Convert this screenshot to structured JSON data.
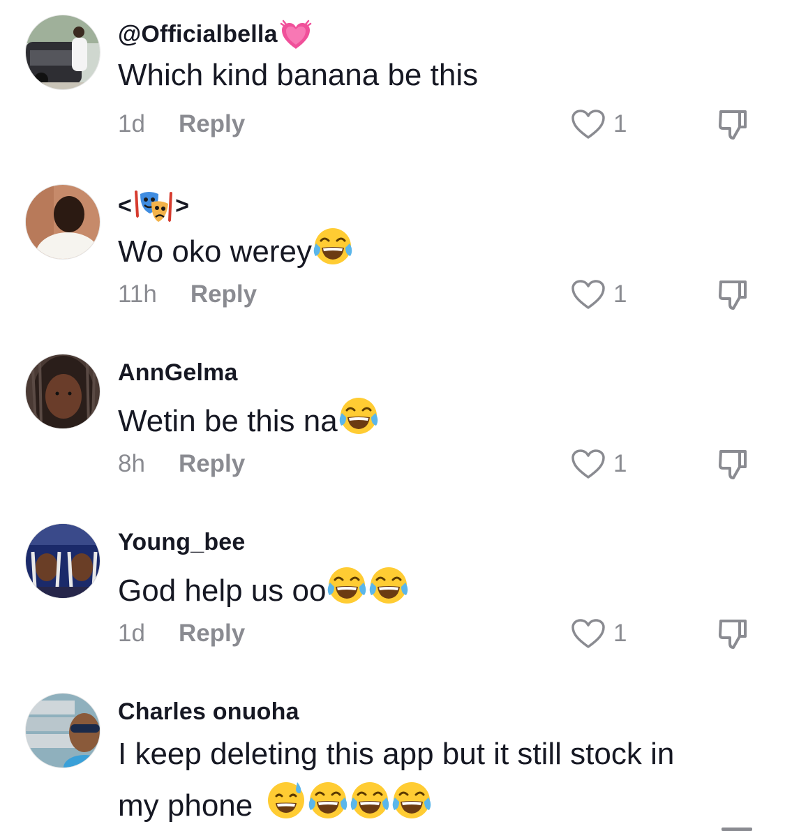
{
  "comments": [
    {
      "username": "@Officialbella",
      "username_emoji": "growing-heart",
      "text": "Which kind banana be this",
      "text_emojis": [],
      "time": "1d",
      "reply_label": "Reply",
      "likes": "1"
    },
    {
      "username": "<",
      "username_suffix": ">",
      "username_emoji": "performing-arts",
      "text": "Wo oko werey",
      "text_emojis": [
        "face-with-tears-of-joy"
      ],
      "time": "11h",
      "reply_label": "Reply",
      "likes": "1"
    },
    {
      "username": "AnnGelma",
      "text": "Wetin be this na",
      "text_emojis": [
        "face-with-tears-of-joy"
      ],
      "time": "8h",
      "reply_label": "Reply",
      "likes": "1"
    },
    {
      "username": "Young_bee",
      "text": "God help us oo",
      "text_emojis": [
        "face-with-tears-of-joy",
        "face-with-tears-of-joy"
      ],
      "time": "1d",
      "reply_label": "Reply",
      "likes": "1"
    },
    {
      "username": "Charles onuoha",
      "text_line1": "I keep deleting this app but it still stock in",
      "text_line2": "my phone",
      "text_emojis": [
        "grinning-face-with-sweat",
        "face-with-tears-of-joy",
        "face-with-tears-of-joy",
        "face-with-tears-of-joy"
      ]
    }
  ],
  "colors": {
    "primary_text": "#161823",
    "secondary_text": "#8a8b91"
  }
}
